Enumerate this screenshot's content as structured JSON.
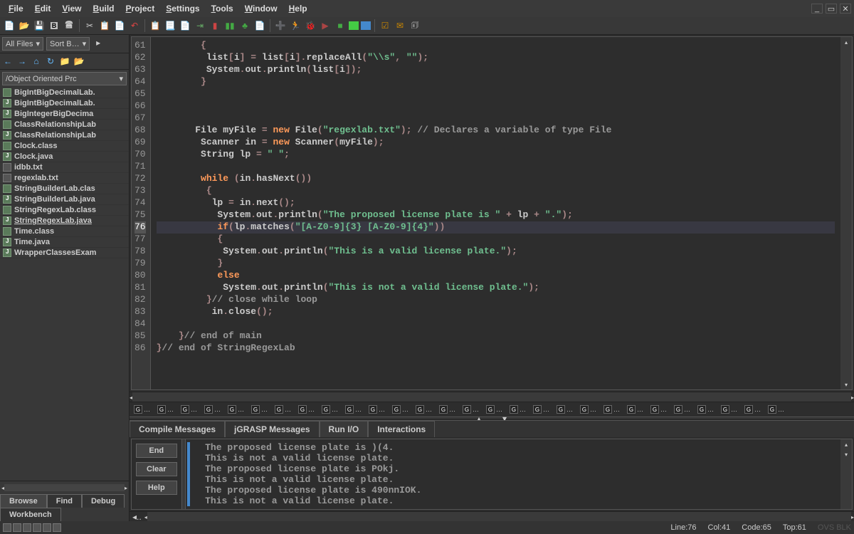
{
  "menu": [
    "File",
    "Edit",
    "View",
    "Build",
    "Project",
    "Settings",
    "Tools",
    "Window",
    "Help"
  ],
  "sidebar": {
    "allFiles": "All Files",
    "sortBy": "Sort B…",
    "path": "/Object Oriented Prc",
    "files": [
      {
        "name": "BigIntBigDecimalLab.",
        "type": "class"
      },
      {
        "name": "BigIntBigDecimalLab.",
        "type": "java"
      },
      {
        "name": "BigIntegerBigDecima",
        "type": "java"
      },
      {
        "name": "ClassRelationshipLab",
        "type": "class"
      },
      {
        "name": "ClassRelationshipLab",
        "type": "java"
      },
      {
        "name": "Clock.class",
        "type": "class"
      },
      {
        "name": "Clock.java",
        "type": "java"
      },
      {
        "name": "idbb.txt",
        "type": "txt"
      },
      {
        "name": "regexlab.txt",
        "type": "txt"
      },
      {
        "name": "StringBuilderLab.clas",
        "type": "class"
      },
      {
        "name": "StringBuilderLab.java",
        "type": "java"
      },
      {
        "name": "StringRegexLab.class",
        "type": "class"
      },
      {
        "name": "StringRegexLab.java",
        "type": "java",
        "selected": true
      },
      {
        "name": "Time.class",
        "type": "class"
      },
      {
        "name": "Time.java",
        "type": "java"
      },
      {
        "name": "WrapperClassesExam",
        "type": "java"
      }
    ],
    "tabs": [
      "Browse",
      "Find",
      "Debug",
      "Workbench"
    ]
  },
  "code": {
    "startLine": 61,
    "hlLine": 76,
    "lines": [
      {
        "n": 61,
        "t": "        {"
      },
      {
        "n": 62,
        "t": "         list[i] = list[i].replaceAll(\"\\\\s\", \"\");"
      },
      {
        "n": 63,
        "t": "         System.out.println(list[i]);"
      },
      {
        "n": 64,
        "t": "        }"
      },
      {
        "n": 65,
        "t": ""
      },
      {
        "n": 66,
        "t": ""
      },
      {
        "n": 67,
        "t": ""
      },
      {
        "n": 68,
        "t": "       File myFile = new File(\"regexlab.txt\"); // Declares a variable of type File"
      },
      {
        "n": 69,
        "t": "        Scanner in = new Scanner(myFile);"
      },
      {
        "n": 70,
        "t": "        String lp = \" \";"
      },
      {
        "n": 71,
        "t": ""
      },
      {
        "n": 72,
        "t": "        while (in.hasNext())"
      },
      {
        "n": 73,
        "t": "         {"
      },
      {
        "n": 74,
        "t": "          lp = in.next();"
      },
      {
        "n": 75,
        "t": "           System.out.println(\"The proposed license plate is \" + lp + \".\");"
      },
      {
        "n": 76,
        "t": "           if(lp.matches(\"[A-Z0-9]{3} [A-Z0-9]{4}\"))",
        "hl": true
      },
      {
        "n": 77,
        "t": "           {"
      },
      {
        "n": 78,
        "t": "            System.out.println(\"This is a valid license plate.\");"
      },
      {
        "n": 79,
        "t": "           }"
      },
      {
        "n": 80,
        "t": "           else"
      },
      {
        "n": 81,
        "t": "            System.out.println(\"This is not a valid license plate.\");"
      },
      {
        "n": 82,
        "t": "         }// close while loop"
      },
      {
        "n": 83,
        "t": "          in.close();"
      },
      {
        "n": 84,
        "t": ""
      },
      {
        "n": 85,
        "t": "    }// end of main"
      },
      {
        "n": 86,
        "t": "}// end of StringRegexLab"
      }
    ]
  },
  "outputTabs": [
    "Compile Messages",
    "jGRASP Messages",
    "Run I/O",
    "Interactions"
  ],
  "outputActive": 2,
  "outputButtons": [
    "End",
    "Clear",
    "Help"
  ],
  "outputLines": [
    "  The proposed license plate is )(4.",
    "  This is not a valid license plate.",
    "  The proposed license plate is POkj.",
    "  This is not a valid license plate.",
    "  The proposed license plate is 490nnIOK.",
    "  This is not a valid license plate."
  ],
  "status": {
    "line": "Line:76",
    "col": "Col:41",
    "code": "Code:65",
    "top": "Top:61",
    "mode": "OVS BLK"
  }
}
